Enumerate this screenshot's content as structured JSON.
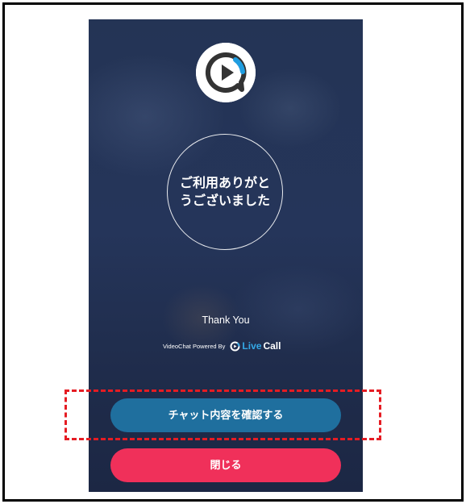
{
  "logo": {
    "icon": "chat-play-icon",
    "colors": {
      "ring": "#333333",
      "accent": "#1f9de0"
    }
  },
  "message": {
    "line1": "ご利用ありがと",
    "line2": "うございました"
  },
  "thank_you": "Thank You",
  "powered_by": {
    "label": "VideoChat Powered By",
    "brand_live": "Live",
    "brand_call": "Call"
  },
  "buttons": {
    "check_chat": "チャット内容を確認する",
    "close": "閉じる"
  },
  "colors": {
    "background": "#24345a",
    "check_chat_button": "#1f6f9e",
    "close_button": "#f0305a",
    "highlight": "#e51c23"
  }
}
